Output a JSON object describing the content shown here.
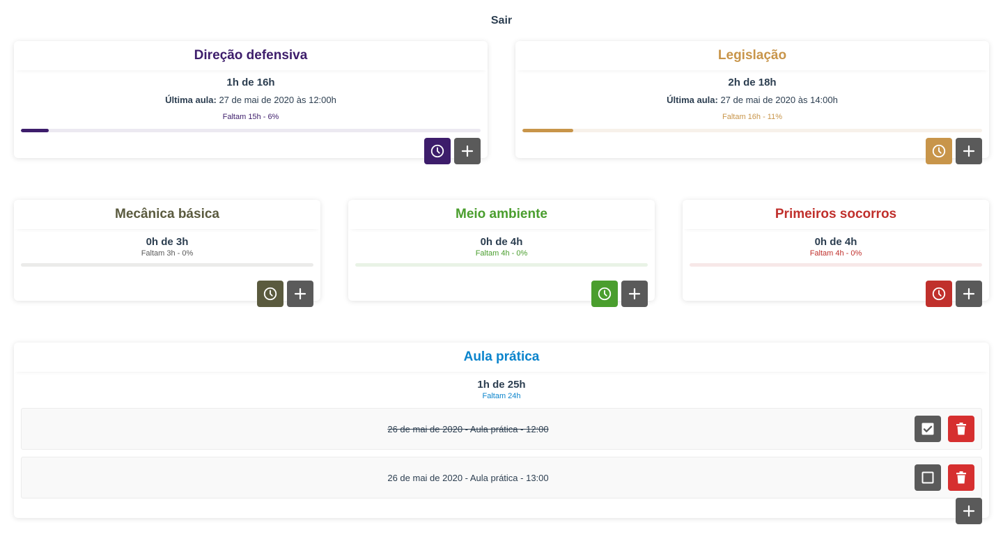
{
  "header": {
    "logout_label": "Sair"
  },
  "icons": {
    "history": "clock-icon",
    "add": "plus-icon",
    "check": "checkbox-checked-icon",
    "uncheck": "checkbox-empty-icon",
    "delete": "trash-icon"
  },
  "courses": [
    {
      "title": "Direção defensiva",
      "color": "#3d1d6b",
      "hours": "1h de 16h",
      "last_label": "Última aula:",
      "last_value": " 27 de mai de 2020 às 12:00h",
      "remaining": "Faltam 15h - 6%",
      "progress": 0.06
    },
    {
      "title": "Legislação",
      "color": "#c8954a",
      "hours": "2h de 18h",
      "last_label": "Última aula:",
      "last_value": " 27 de mai de 2020 às 14:00h",
      "remaining": "Faltam 16h - 11%",
      "progress": 0.11
    },
    {
      "title": "Mecânica básica",
      "color": "#5a5a3e",
      "hours": "0h de 3h",
      "remaining": "Faltam 3h - 0%",
      "progress": 0
    },
    {
      "title": "Meio ambiente",
      "color": "#4a9e2e",
      "hours": "0h de 4h",
      "remaining": "Faltam 4h - 0%",
      "progress": 0
    },
    {
      "title": "Primeiros socorros",
      "color": "#c0302c",
      "hours": "0h de 4h",
      "remaining": "Faltam 4h - 0%",
      "progress": 0
    }
  ],
  "practice": {
    "title": "Aula prática",
    "color": "#0b84cc",
    "hours": "1h de 25h",
    "remaining": "Faltam 24h",
    "items": [
      {
        "text": "26 de mai de 2020 - Aula prática - 12:00",
        "done": true
      },
      {
        "text": "26 de mai de 2020 - Aula prática - 13:00",
        "done": false
      }
    ]
  }
}
